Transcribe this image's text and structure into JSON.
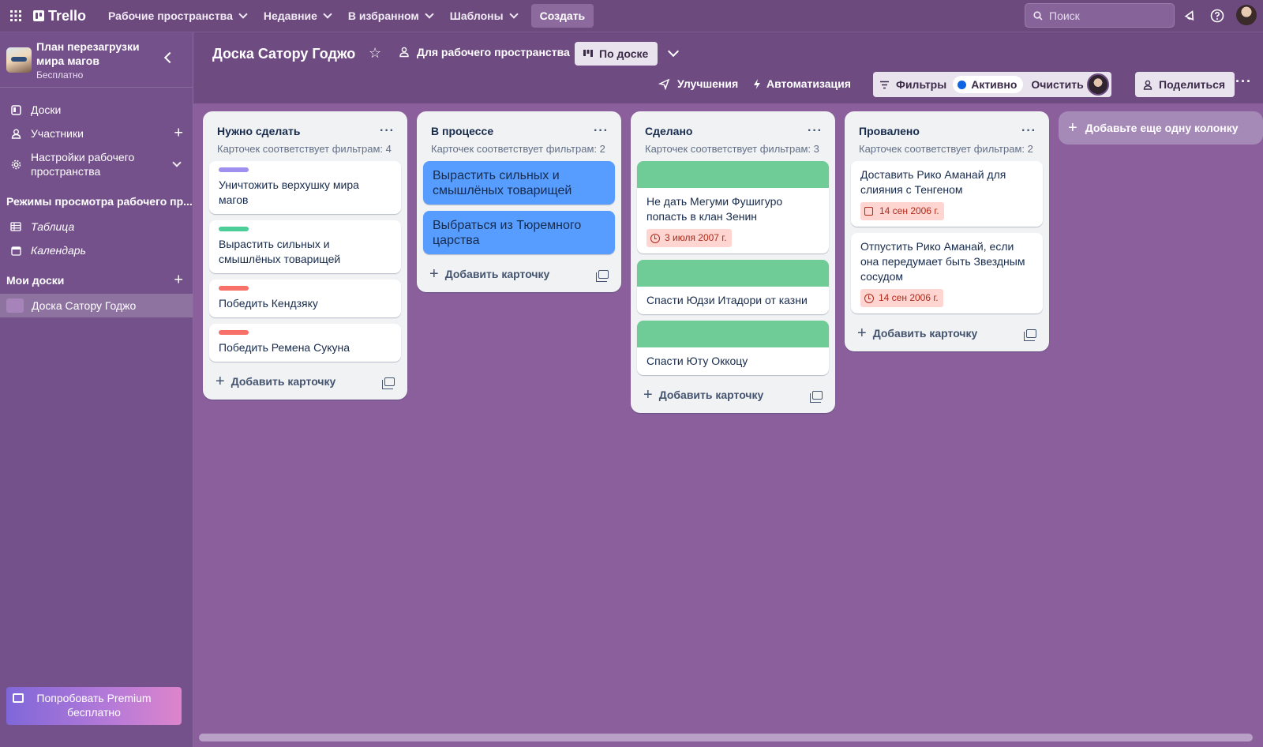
{
  "topbar": {
    "logo": "Trello",
    "nav": [
      {
        "label": "Рабочие пространства"
      },
      {
        "label": "Недавние"
      },
      {
        "label": "В избранном"
      },
      {
        "label": "Шаблоны"
      }
    ],
    "create": "Создать",
    "search_placeholder": "Поиск"
  },
  "sidebar": {
    "workspace_title": "План перезагрузки мира магов",
    "workspace_plan": "Бесплатно",
    "items": [
      {
        "label": "Доски"
      },
      {
        "label": "Участники"
      },
      {
        "label": "Настройки рабочего пространства"
      }
    ],
    "views_header": "Режимы просмотра рабочего пр...",
    "views": [
      {
        "label": "Таблица"
      },
      {
        "label": "Календарь"
      }
    ],
    "my_boards_header": "Мои доски",
    "boards": [
      {
        "label": "Доска Сатору Годжо"
      }
    ],
    "premium": "Попробовать Premium бесплатно"
  },
  "board": {
    "title": "Доска Сатору Годжо",
    "visibility": "Для рабочего пространства",
    "view": "По доске",
    "powerups": "Улучшения",
    "automation": "Автоматизация",
    "filters": "Фильтры",
    "active": "Активно",
    "clear_all": "Очистить все",
    "share": "Поделиться",
    "add_list": "Добавьте еще одну колонку",
    "add_card": "Добавить карточку"
  },
  "lists": [
    {
      "title": "Нужно сделать",
      "sub": "Карточек соответствует фильтрам: 4",
      "cards": [
        {
          "text": "Уничтожить верхушку мира магов",
          "label_color": "#9f8fef"
        },
        {
          "text": "Вырастить сильных и смышлёных товарищей",
          "label_color": "#4bce97"
        },
        {
          "text": "Победить Кендзяку",
          "label_color": "#f87168"
        },
        {
          "text": "Победить Ремена Сукуна",
          "label_color": "#f87168"
        }
      ]
    },
    {
      "title": "В процессе",
      "sub": "Карточек соответствует фильтрам: 2",
      "cards": [
        {
          "text": "Вырастить сильных и смышлёных товарищей",
          "bg": "#579dff"
        },
        {
          "text": "Выбраться из Тюремного царства",
          "bg": "#579dff"
        }
      ]
    },
    {
      "title": "Сделано",
      "sub": "Карточек соответствует фильтрам: 3",
      "cards": [
        {
          "text": "Не дать Мегуми Фушигуро попасть в клан Зенин",
          "cover": "#6fcc97",
          "due": "3 июля 2007 г."
        },
        {
          "text": "Спасти Юдзи Итадори от казни",
          "cover": "#6fcc97"
        },
        {
          "text": "Спасти Юту Оккоцу",
          "cover": "#6fcc97"
        }
      ]
    },
    {
      "title": "Провалено",
      "sub": "Карточек соответствует фильтрам: 2",
      "cards": [
        {
          "text": "Доставить Рико Аманай для слияния с Тенгеном",
          "due": "14 сен 2006 г.",
          "due_icon": "checkbox-icon"
        },
        {
          "text": "Отпустить Рико Аманай, если она передумает быть Звездным сосудом",
          "due": "14 сен 2006 г.",
          "due_icon": "clock-icon"
        }
      ]
    }
  ]
}
